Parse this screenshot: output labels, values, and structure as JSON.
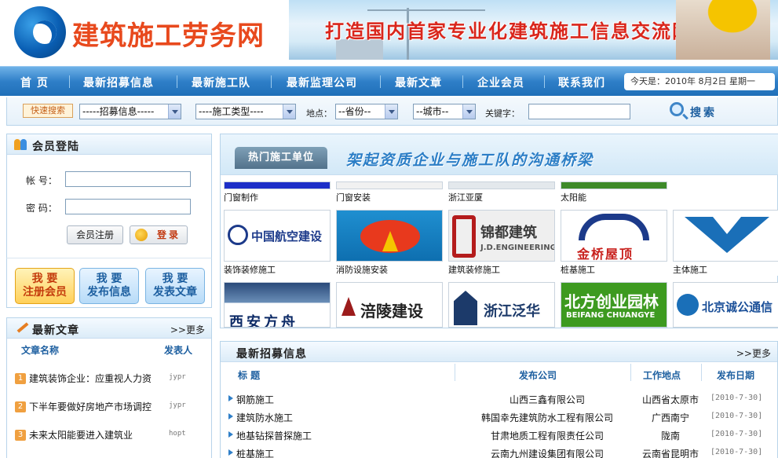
{
  "header": {
    "site_title": "建筑施工劳务网",
    "banner_slogan": "打造国内首家专业化建筑施工信息交流网站"
  },
  "nav": {
    "items": [
      "首 页",
      "最新招募信息",
      "最新施工队",
      "最新监理公司",
      "最新文章",
      "企业会员",
      "联系我们"
    ],
    "date": "今天是：2010年 8月2日 星期一"
  },
  "search": {
    "quick_label": "快速搜索",
    "recruit_select": "-----招募信息-----",
    "type_select": "----施工类型----",
    "location_label": "地点：",
    "province_select": "--省份--",
    "city_select": "--城市--",
    "keyword_label": "关键字：",
    "search_label": "搜索"
  },
  "login": {
    "title": "会员登陆",
    "account_label": "帐 号：",
    "password_label": "密 码：",
    "register_button": "会员注册",
    "login_button": "登录"
  },
  "quick_actions": [
    {
      "line1": "我 要",
      "line2": "注册会员"
    },
    {
      "line1": "我 要",
      "line2": "发布信息"
    },
    {
      "line1": "我 要",
      "line2": "发表文章"
    }
  ],
  "articles": {
    "title": "最新文章",
    "more": ">>更多",
    "col_name": "文章名称",
    "col_author": "发表人",
    "items": [
      {
        "num": "1",
        "title": "建筑装饰企业：应重视人力资",
        "author": "jypr"
      },
      {
        "num": "2",
        "title": "下半年要做好房地产市场调控",
        "author": "jypr"
      },
      {
        "num": "3",
        "title": "未来太阳能要进入建筑业",
        "author": "hopt"
      }
    ]
  },
  "featured": {
    "tab": "热门施工单位",
    "slogan": "架起资质企业与施工队的沟通桥梁",
    "row1": [
      "门窗制作",
      "门窗安装",
      "浙江亚厦",
      "太阳能"
    ],
    "row2": [
      {
        "caption": "装饰装修施工",
        "logo": "中国航空建设"
      },
      {
        "caption": "消防设施安装",
        "logo": ""
      },
      {
        "caption": "建筑装修施工",
        "logo": "锦都建筑",
        "logo_sub": "J.D.ENGINEERING"
      },
      {
        "caption": "桩基施工",
        "logo": "金桥屋顶"
      },
      {
        "caption": "主体施工",
        "logo": ""
      }
    ],
    "row3": [
      {
        "logo": "西安方舟"
      },
      {
        "logo": "涪陵建设"
      },
      {
        "logo": "浙江泛华"
      },
      {
        "logo": "北方创业园林",
        "logo_sub": "BEIFANG CHUANGYE"
      },
      {
        "logo": "北京诚公通信"
      }
    ]
  },
  "recruit": {
    "title": "最新招募信息",
    "more": ">>更多",
    "col_title": "标 题",
    "col_company": "发布公司",
    "col_location": "工作地点",
    "col_date": "发布日期",
    "rows": [
      {
        "title": "钢筋施工",
        "company": "山西三鑫有限公司",
        "location": "山西省太原市",
        "date": "[2010-7-30]"
      },
      {
        "title": "建筑防水施工",
        "company": "韩国幸先建筑防水工程有限公司",
        "location": "广西南宁",
        "date": "[2010-7-30]"
      },
      {
        "title": "地基钻探普探施工",
        "company": "甘肃地质工程有限责任公司",
        "location": "陇南",
        "date": "[2010-7-30]"
      },
      {
        "title": "桩基施工",
        "company": "云南九州建设集团有限公司",
        "location": "云南省昆明市",
        "date": "[2010-7-30]"
      }
    ]
  },
  "colors": {
    "nav_blue": "#2f7fc8",
    "title_red": "#e8491d",
    "link_blue": "#1d5fa0"
  }
}
